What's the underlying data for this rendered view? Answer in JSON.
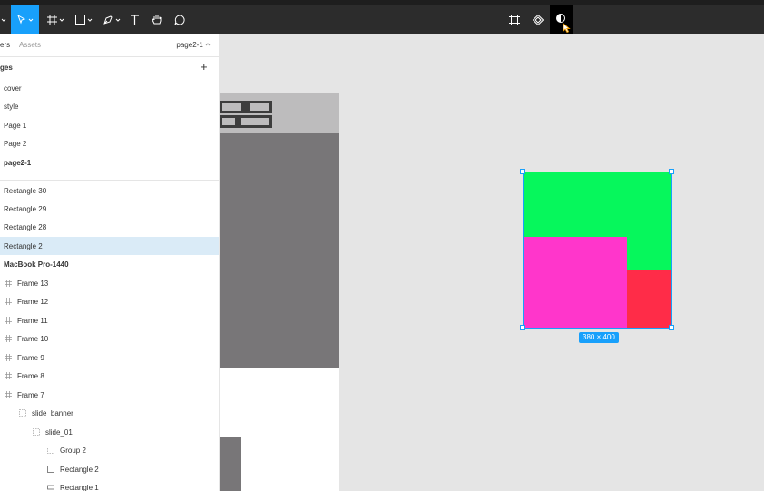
{
  "colors": {
    "accent": "#18a0fb",
    "toolbar_bg": "#2c2c2c",
    "selected_row": "#daebf7",
    "shape_green": "#06f75c",
    "shape_magenta": "#ff36cb",
    "shape_red": "#ff2c48"
  },
  "toolbar": {
    "tools": [
      "move-icon",
      "frame-icon",
      "rectangle-icon",
      "pen-icon",
      "text-icon",
      "hand-icon",
      "comment-icon"
    ],
    "right_tools": [
      "component-icon",
      "instance-icon",
      "theme-toggle-icon"
    ]
  },
  "panel": {
    "tab_layers": "ers",
    "tab_assets": "Assets",
    "current_page": "page2-1",
    "pages_header": "ges",
    "pages": [
      "cover",
      "style",
      "Page 1",
      "Page 2",
      "page2-1"
    ],
    "layers": [
      {
        "label": "Rectangle 30"
      },
      {
        "label": "Rectangle 29"
      },
      {
        "label": "Rectangle 28"
      },
      {
        "label": "Rectangle 2"
      },
      {
        "label": "MacBook Pro-1440"
      },
      {
        "label": "Frame 13"
      },
      {
        "label": "Frame 12"
      },
      {
        "label": "Frame 11"
      },
      {
        "label": "Frame 10"
      },
      {
        "label": "Frame 9"
      },
      {
        "label": "Frame 8"
      },
      {
        "label": "Frame 7"
      },
      {
        "label": "slide_banner"
      },
      {
        "label": "slide_01"
      },
      {
        "label": "Group 2"
      },
      {
        "label": "Rectangle 2"
      },
      {
        "label": "Rectangle 1"
      }
    ]
  },
  "canvas": {
    "selection_size": "380 × 400"
  }
}
